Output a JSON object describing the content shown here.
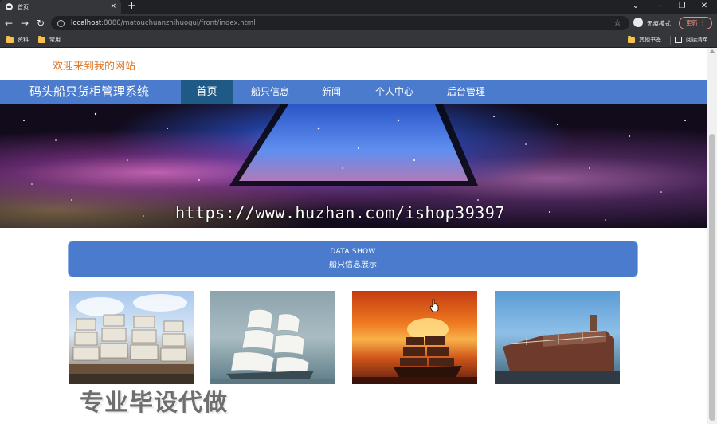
{
  "browser": {
    "tab_title": "首页",
    "tab_close": "×",
    "new_tab": "+",
    "window_controls": {
      "dropdown": "⌄",
      "minimize": "–",
      "restore": "❐",
      "close": "✕"
    },
    "nav": {
      "back": "←",
      "forward": "→",
      "reload": "↻"
    },
    "info": "i",
    "url_host": "localhost",
    "url_path": ":8080/matouchuanzhihuogui/front/index.html",
    "star": "☆",
    "incognito_label": "无痕模式",
    "update_label": "更新  ⋮",
    "bookmarks": [
      "资料",
      "常用"
    ],
    "other_bookmarks": "其他书签",
    "reading_list": "阅读清单"
  },
  "site": {
    "welcome": "欢迎来到我的网站",
    "brand": "码头船只货柜管理系统",
    "nav": [
      {
        "label": "首页",
        "active": true
      },
      {
        "label": "船只信息",
        "active": false
      },
      {
        "label": "新闻",
        "active": false
      },
      {
        "label": "个人中心",
        "active": false
      },
      {
        "label": "后台管理",
        "active": false
      }
    ],
    "banner_watermark": "https://www.huzhan.com/ishop39397",
    "data_show": {
      "title": "DATA SHOW",
      "subtitle": "船只信息展示"
    },
    "bottom_watermark": "专业毕设代做"
  }
}
